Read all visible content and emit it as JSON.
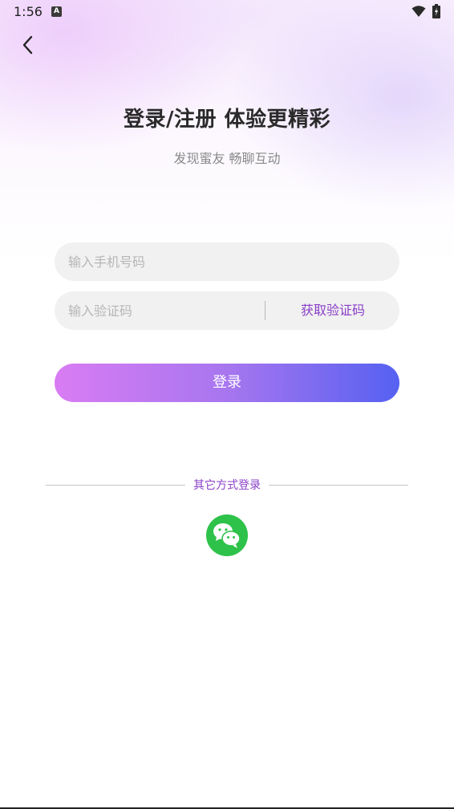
{
  "status_bar": {
    "time": "1:56",
    "notification_icon": "A"
  },
  "header": {
    "back_icon": "chevron-left-icon",
    "title": "登录/注册 体验更精彩",
    "subtitle": "发现蜜友 畅聊互动"
  },
  "form": {
    "phone_placeholder": "输入手机号码",
    "phone_value": "",
    "code_placeholder": "输入验证码",
    "code_value": "",
    "get_code_label": "获取验证码",
    "login_label": "登录"
  },
  "other_login": {
    "label": "其它方式登录",
    "wechat_icon": "wechat-icon"
  },
  "colors": {
    "accent_text": "#8a3fc8",
    "gradient_start": "#d97cf3",
    "gradient_end": "#5661f1",
    "wechat_green": "#2ec24a"
  }
}
